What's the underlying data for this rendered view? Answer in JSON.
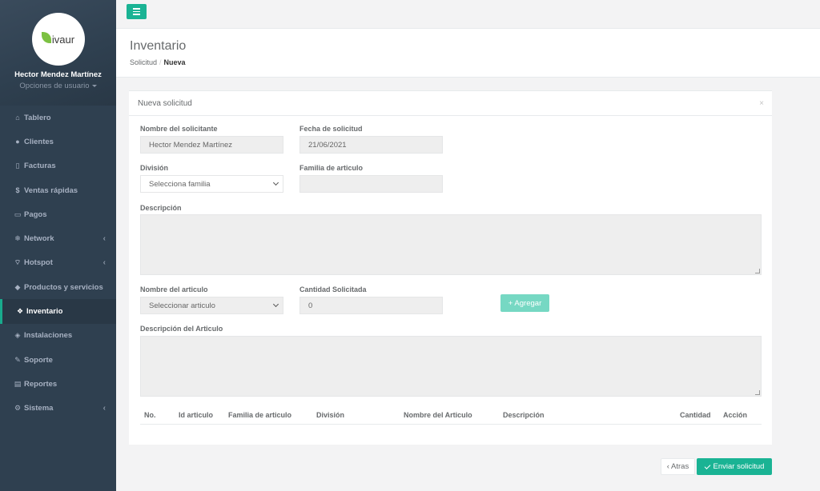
{
  "sidebar": {
    "logo_text": "ivaur",
    "logo_initial": "L",
    "user_name": "Hector Mendez Martínez",
    "user_options": "Opciones de usuario",
    "items": [
      {
        "label": "Tablero",
        "icon": "dashboard-icon",
        "glyph": "⌂"
      },
      {
        "label": "Clientes",
        "icon": "users-icon",
        "glyph": "👥"
      },
      {
        "label": "Facturas",
        "icon": "file-icon",
        "glyph": "▯"
      },
      {
        "label": "Ventas rápidas",
        "icon": "dollar-icon",
        "glyph": "$"
      },
      {
        "label": "Pagos",
        "icon": "laptop-icon",
        "glyph": "▭"
      },
      {
        "label": "Network",
        "icon": "network-icon",
        "glyph": "❄"
      },
      {
        "label": "Hotspot",
        "icon": "wifi-icon",
        "glyph": "⌔"
      },
      {
        "label": "Productos y servicios",
        "icon": "tag-icon",
        "glyph": "◆"
      },
      {
        "label": "Inventario",
        "icon": "cubes-icon",
        "glyph": "❖"
      },
      {
        "label": "Instalaciones",
        "icon": "tool-icon",
        "glyph": "◈"
      },
      {
        "label": "Soporte",
        "icon": "wrench-icon",
        "glyph": "✎"
      },
      {
        "label": "Reportes",
        "icon": "book-icon",
        "glyph": "▤"
      },
      {
        "label": "Sistema",
        "icon": "cogs-icon",
        "glyph": "⚙"
      }
    ],
    "chevron": "‹"
  },
  "header": {
    "title": "Inventario",
    "breadcrumb_parent": "Solicitud",
    "breadcrumb_sep": "/",
    "breadcrumb_current": "Nueva"
  },
  "panel": {
    "title": "Nueva solicitud",
    "close": "×"
  },
  "form": {
    "requester_label": "Nombre del solicitante",
    "requester_value": "Hector Mendez Martínez",
    "date_label": "Fecha de solicitud",
    "date_value": "21/06/2021",
    "division_label": "División",
    "division_value": "Selecciona familia",
    "family_label": "Familia de articulo",
    "family_value": "",
    "description_label": "Descripción",
    "article_label": "Nombre del articulo",
    "article_value": "Seleccionar articulo",
    "quantity_label": "Cantidad Solicitada",
    "quantity_value": "0",
    "add_button": "+ Agregar",
    "article_desc_label": "Descripción del Articulo"
  },
  "table": {
    "headers": [
      "No.",
      "Id articulo",
      "Familia de articulo",
      "División",
      "Nombre del Articulo",
      "Descripción",
      "Cantidad",
      "Acción"
    ]
  },
  "footer": {
    "back_button": "‹ Atras",
    "send_button": "Enviar solicitud"
  },
  "colors": {
    "sidebar": "#2f4050",
    "accent": "#1ab394",
    "accent_light": "#76d8c3"
  }
}
